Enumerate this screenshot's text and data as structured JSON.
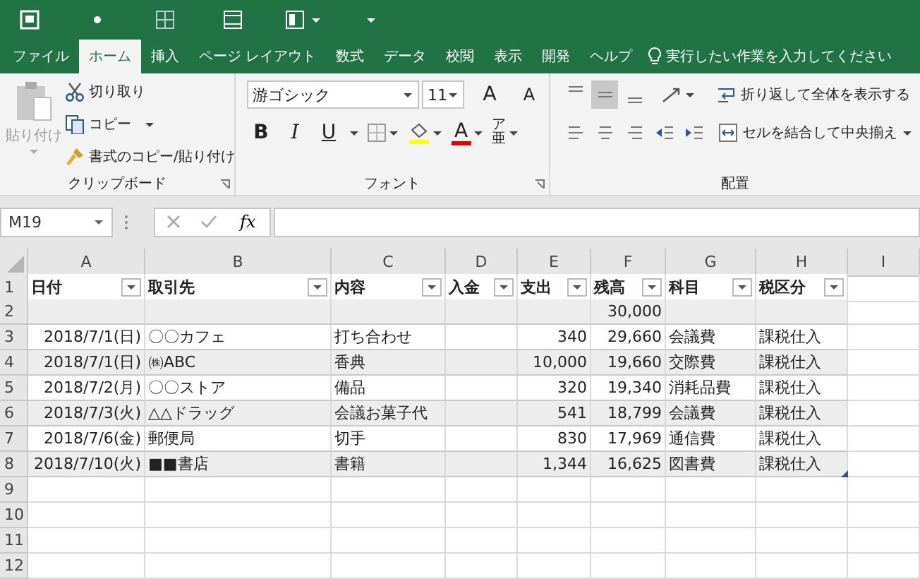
{
  "tabs": [
    {
      "label": "ファイル",
      "selected": false
    },
    {
      "label": "ホーム",
      "selected": true
    },
    {
      "label": "挿入",
      "selected": false
    },
    {
      "label": "ページ レイアウト",
      "selected": false
    },
    {
      "label": "数式",
      "selected": false
    },
    {
      "label": "データ",
      "selected": false
    },
    {
      "label": "校閲",
      "selected": false
    },
    {
      "label": "表示",
      "selected": false
    },
    {
      "label": "開発",
      "selected": false
    },
    {
      "label": "ヘルプ",
      "selected": false
    }
  ],
  "tell_me": {
    "label": "実行したい作業を入力してください"
  },
  "clipboard": {
    "paste": {
      "label": "貼り付け",
      "disabled": true
    },
    "cut": "切り取り",
    "copy": "コピー",
    "format_painter": "書式のコピー/貼り付け",
    "group_label": "クリップボード"
  },
  "font": {
    "font_name": "游ゴシック",
    "font_size": "11",
    "grow": "A",
    "shrink": "A",
    "bold": "B",
    "italic": "I",
    "underline": "U",
    "font_color": "A",
    "phonetic_ruby": "ア",
    "phonetic": "亜",
    "group_label": "フォント"
  },
  "alignment": {
    "vertical": [
      {
        "selected": false
      },
      {
        "selected": true
      },
      {
        "selected": false
      }
    ],
    "wrap_text": "折り返して全体を表示する",
    "merge": "セルを結合して中央揃え",
    "group_label": "配置"
  },
  "formula_bar": {
    "name_box": "M19",
    "fx": "fx"
  },
  "sheet": {
    "columns": [
      "A",
      "B",
      "C",
      "D",
      "E",
      "F",
      "G",
      "H",
      "I"
    ],
    "header_row": {
      "number": "1",
      "cells": [
        "日付",
        "取引先",
        "内容",
        "入金",
        "支出",
        "残高",
        "科目",
        "税区分"
      ]
    },
    "table_rows": [
      {
        "number": "2",
        "F": "30,000"
      },
      {
        "number": "3",
        "A": "2018/7/1(日)",
        "B": "〇〇カフェ",
        "C": "打ち合わせ",
        "E": "340",
        "F": "29,660",
        "G": "会議費",
        "H": "課税仕入"
      },
      {
        "number": "4",
        "A": "2018/7/1(日)",
        "B": "㈱ABC",
        "C": "香典",
        "E": "10,000",
        "F": "19,660",
        "G": "交際費",
        "H": "課税仕入"
      },
      {
        "number": "5",
        "A": "2018/7/2(月)",
        "B": "〇〇ストア",
        "C": "備品",
        "E": "320",
        "F": "19,340",
        "G": "消耗品費",
        "H": "課税仕入"
      },
      {
        "number": "6",
        "A": "2018/7/3(火)",
        "B": "△△ドラッグ",
        "C": "会議お菓子代",
        "E": "541",
        "F": "18,799",
        "G": "会議費",
        "H": "課税仕入"
      },
      {
        "number": "7",
        "A": "2018/7/6(金)",
        "B": "郵便局",
        "C": "切手",
        "E": "830",
        "F": "17,969",
        "G": "通信費",
        "H": "課税仕入"
      },
      {
        "number": "8",
        "A": "2018/7/10(火)",
        "B": "■■書店",
        "C": "書籍",
        "E": "1,344",
        "F": "16,625",
        "G": "図書費",
        "H": "課税仕入"
      }
    ],
    "empty_rows": [
      "9",
      "10",
      "11",
      "12"
    ]
  }
}
